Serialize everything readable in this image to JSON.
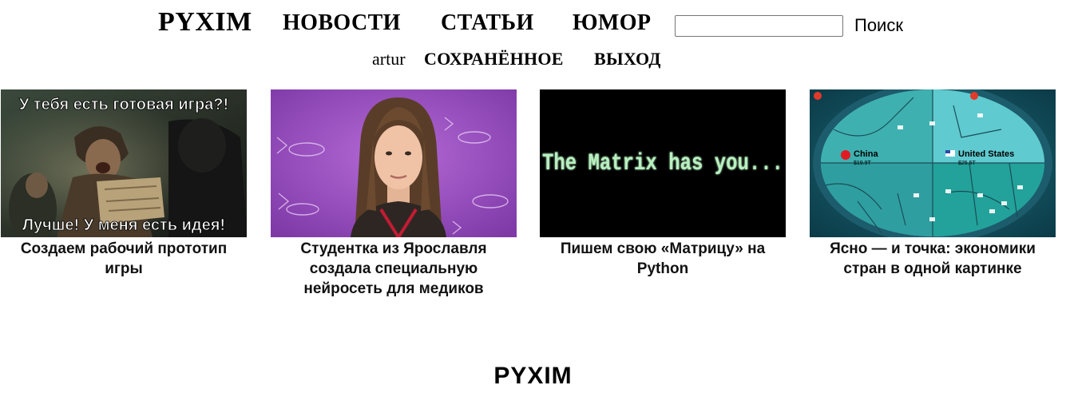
{
  "header": {
    "logo": "PYXIM",
    "nav": {
      "news": "НОВОСТИ",
      "articles": "СТАТЬИ",
      "humor": "ЮМОР"
    },
    "search": {
      "value": "",
      "placeholder": "",
      "button_label": "Поиск"
    },
    "user": {
      "name": "artur",
      "saved": "СОХРАНЁННОЕ",
      "logout": "ВЫХОД"
    }
  },
  "cards": [
    {
      "title": "Создаем рабочий прототип игры",
      "image_text_top": "У тебя есть готовая игра?!",
      "image_text_bottom": "Лучше! У меня есть идея!"
    },
    {
      "title": "Студентка из Ярославля создала специальную нейросеть для медиков"
    },
    {
      "title": "Пишем свою «Матрицу» на Python",
      "image_text": "The Matrix has you..."
    },
    {
      "title": "Ясно — и точка: экономики стран в одной картинке",
      "image_labels": {
        "china": "China",
        "china_value": "$19.9T",
        "usa": "United States",
        "usa_value": "$25.5T"
      }
    }
  ],
  "footer": {
    "logo": "PYXIM"
  },
  "colors": {
    "background": "#ffffff",
    "text": "#000000",
    "matrix_green": "#b8f0c0",
    "purple_backdrop": "#9b4fc4",
    "map_teal": "#3fb6b4"
  }
}
